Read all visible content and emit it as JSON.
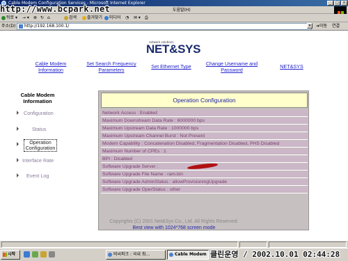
{
  "window": {
    "title": "Cable Modem Configuration Services - Microsoft Internet Explorer",
    "watermark": "http://www.bcpark.net",
    "help_menu": "도움말(H)"
  },
  "toolbar": {
    "back": "뒤로",
    "search": "검색",
    "favorites": "즐겨찾기",
    "media": "미디어"
  },
  "address": {
    "label": "주소(D)",
    "url": "http://192.168.100.1/",
    "go": "이동",
    "links": "연결"
  },
  "page": {
    "logo_tagline": "network solutions",
    "logo_text": "NET&SYS",
    "nav": [
      {
        "label": "Cable Modem Information"
      },
      {
        "label": "Set Search Frequency Parameters"
      },
      {
        "label": "Set Ethernet Type"
      },
      {
        "label": "Change Username and Password"
      },
      {
        "label": "NET&SYS"
      }
    ],
    "sidebar": {
      "title": "Cable Modem Information",
      "items": [
        {
          "label": "Configuration"
        },
        {
          "label": "Status"
        },
        {
          "label": "Operation Configuration"
        },
        {
          "label": "Interface Rate"
        },
        {
          "label": "Event Log"
        }
      ]
    },
    "panel": {
      "title": "Operation Configuration",
      "rows": [
        "Network Access : Enabled",
        "Maximum Downstream Data Rate : 6000000 bps",
        "Maximum Upstream Data Rate : 1000000 bps",
        "Maximum Upstream Channel Burst : Not Present",
        "Modem Capability : Concatenation Disabled, Fragmentation Disabled, PHS Disabled",
        "Maximum Number of CPEs : 1",
        "BPI : Disabled",
        "Software Upgrade Server :",
        "Software Upgrade File Name : ram.bin",
        "Software Upgrade AdminStatus : allowProvisioningUpgrade",
        "Software Upgrade OperStatus : other"
      ]
    },
    "footer": {
      "copyright": "Copyrights (C) 2001 Net&Sys Co., Ltd. All Rights Reserved.",
      "best_view": "Best view with 1024*768 screen mode"
    }
  },
  "taskbar": {
    "start": "시작",
    "tasks": [
      "비씨파크 : 국내 최...",
      "Cable Modem C..."
    ],
    "clock": "클린운영 / 2002.10.01 02:44:28"
  }
}
